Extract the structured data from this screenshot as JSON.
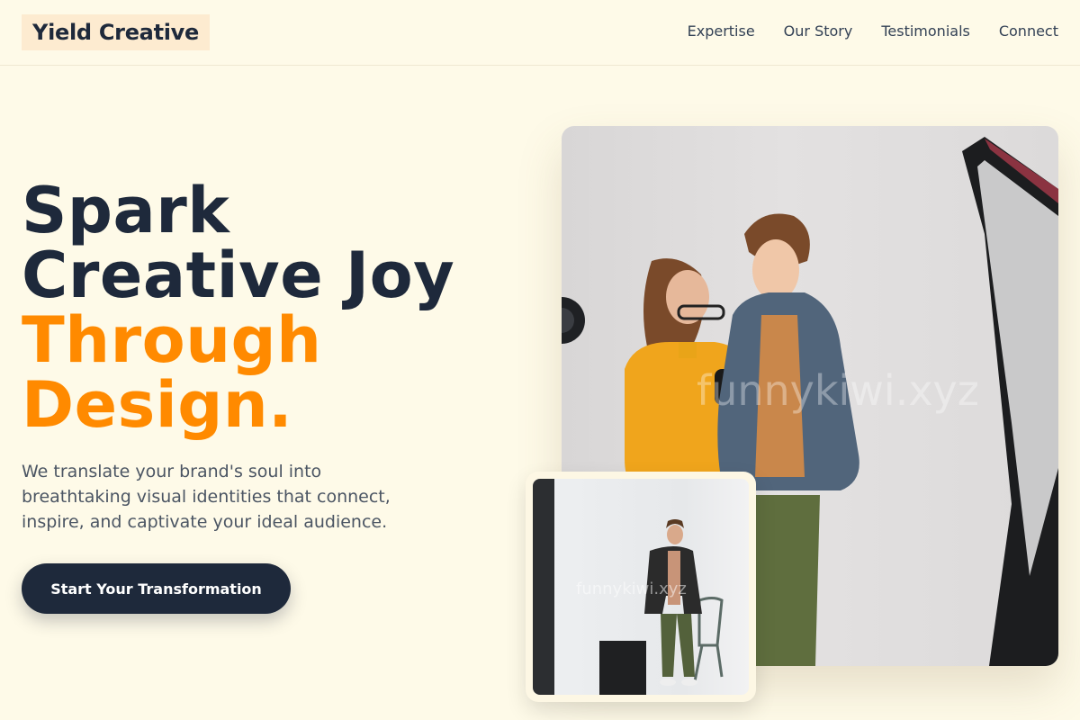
{
  "header": {
    "logo": "Yield Creative",
    "nav": [
      "Expertise",
      "Our Story",
      "Testimonials",
      "Connect"
    ]
  },
  "hero": {
    "title_line1": "Spark",
    "title_line2": "Creative Joy",
    "title_line3": "Through",
    "title_line4": "Design.",
    "description": "We translate your brand's soul into breathtaking visual identities that connect, inspire, and captivate your ideal audience.",
    "cta_label": "Start Your Transformation"
  },
  "images": {
    "main_watermark": "funnykiwi.xyz",
    "small_watermark": "funnykiwi.xyz"
  },
  "colors": {
    "background": "#fefae8",
    "navy": "#1e293b",
    "accent": "#ff8a00",
    "logo_bg": "#fdebd0"
  }
}
